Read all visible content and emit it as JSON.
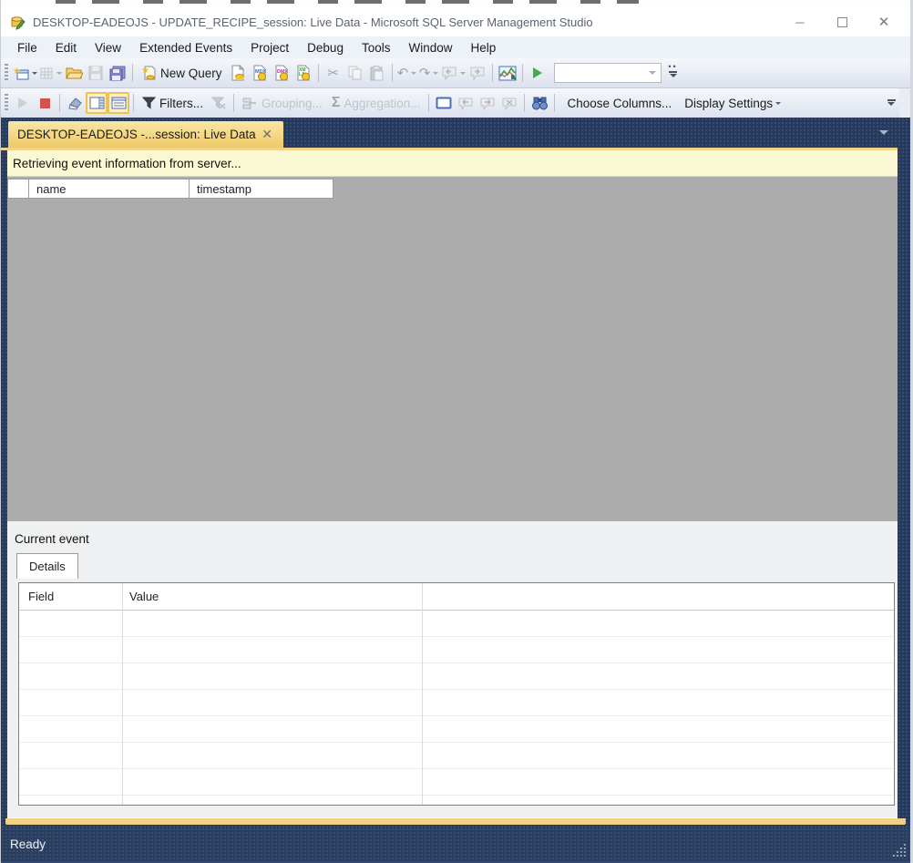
{
  "window": {
    "title": "DESKTOP-EADEOJS - UPDATE_RECIPE_session: Live Data - Microsoft SQL Server Management Studio"
  },
  "menu": {
    "items": [
      "File",
      "Edit",
      "View",
      "Extended Events",
      "Project",
      "Debug",
      "Tools",
      "Window",
      "Help"
    ]
  },
  "toolbars": {
    "standard": {
      "new_query": "New Query"
    },
    "xe": {
      "filters": "Filters...",
      "grouping": "Grouping...",
      "aggregation": "Aggregation...",
      "choose_columns": "Choose Columns...",
      "display_settings": "Display Settings"
    }
  },
  "tab": {
    "label": "DESKTOP-EADEOJS -...session: Live Data"
  },
  "notification": "Retrieving event information from server...",
  "events_grid": {
    "columns": [
      "name",
      "timestamp"
    ]
  },
  "current_event": {
    "label": "Current event",
    "tab_label": "Details",
    "columns": [
      "Field",
      "Value"
    ],
    "empty_rows": 7
  },
  "status": {
    "text": "Ready"
  },
  "glyphs": {
    "minimize": "─",
    "close": "✕",
    "tab_close": "✕",
    "scissors": "✂",
    "undo": "↶",
    "redo": "↷",
    "sigma": "Σ",
    "star": "★",
    "overflow_dots": "••"
  },
  "colors": {
    "frame_navy": "#253a5e",
    "tab_amber": "#efc968",
    "notification_bg": "#fbf9d4",
    "grid_empty_bg": "#acacac",
    "start_green": "#3fae49",
    "stop_red": "#d2524e",
    "toggle_highlight": "#ecc255"
  }
}
